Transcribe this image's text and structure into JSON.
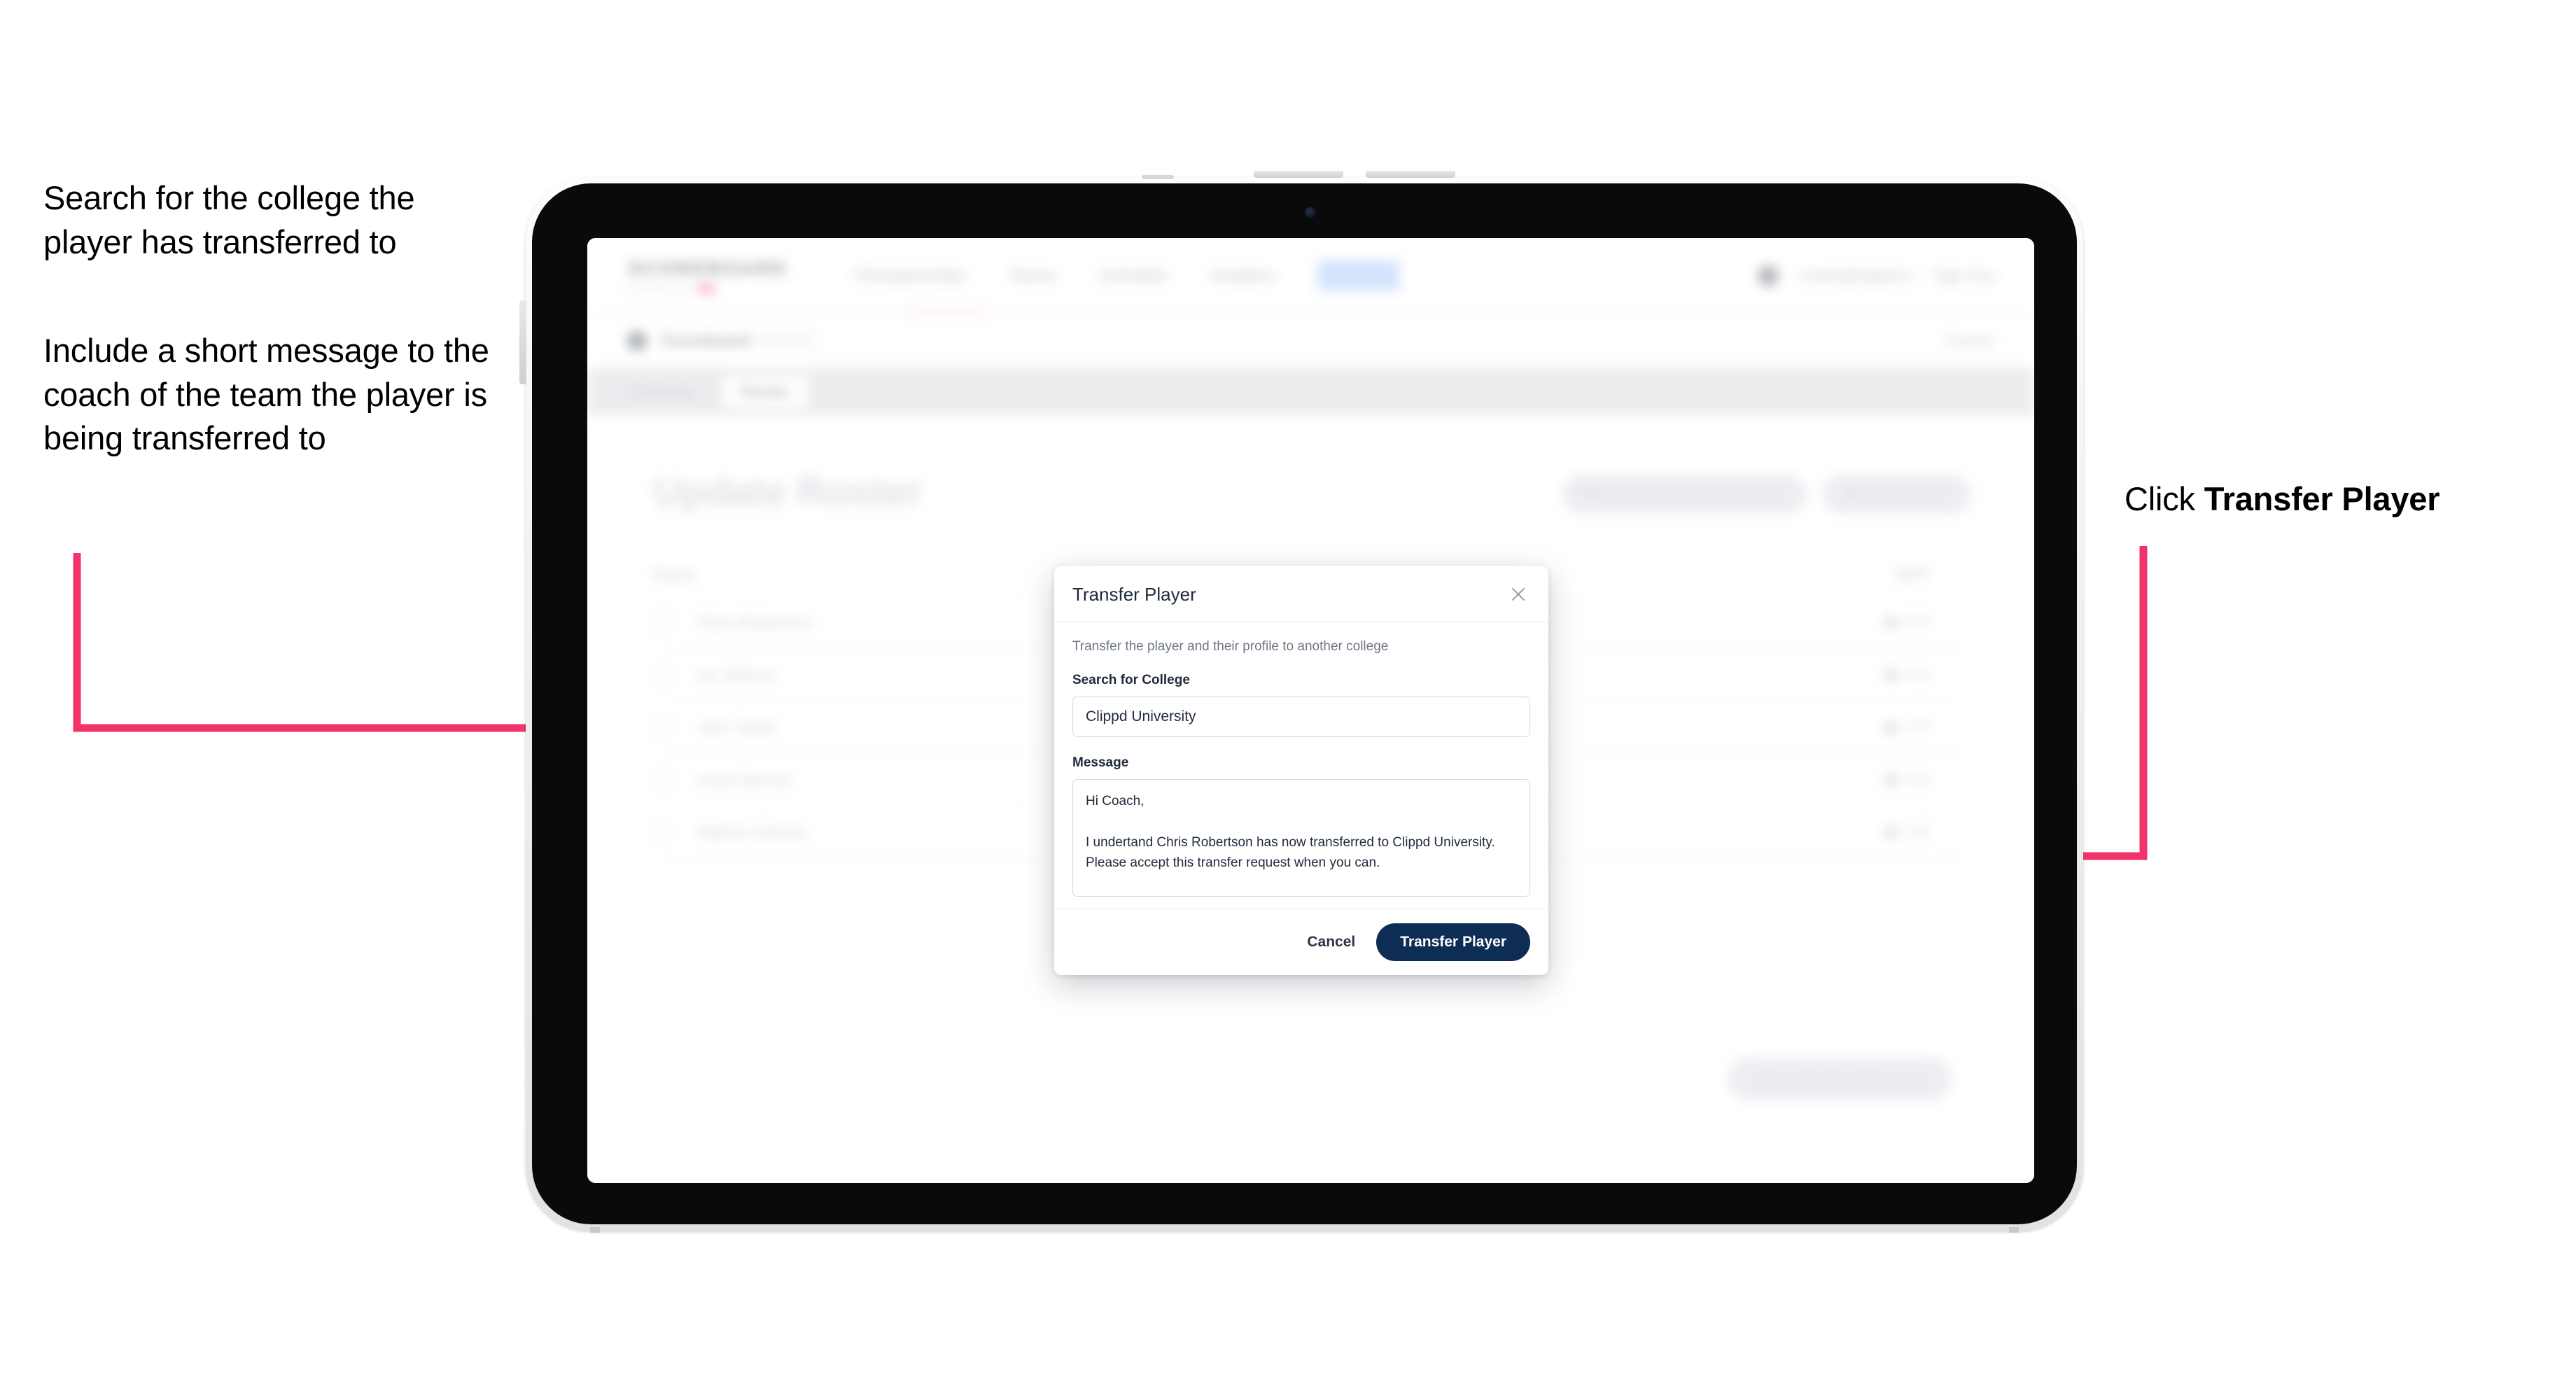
{
  "annotations": {
    "left_1": "Search for the college the player has transferred to",
    "left_2": "Include a short message to the coach of the team the player is being transferred to",
    "right_prefix": "Click ",
    "right_strong": "Transfer Player"
  },
  "colors": {
    "accent_pink": "#f2336b",
    "brand_navy": "#0e2d54",
    "brand_pink": "#f43f69"
  },
  "app": {
    "brand": {
      "word": "SCOREBOARD",
      "sub": "POWERED BY",
      "dot_icon": "brand-dot-icon"
    },
    "nav": [
      {
        "label": "Championships"
      },
      {
        "label": "Teams"
      },
      {
        "label": "Schedule"
      },
      {
        "label": "Analytics"
      },
      {
        "label": "Roster"
      }
    ],
    "top_right": {
      "avatar": "avatar-icon",
      "account": "coach@clippd.io",
      "signout": "Sign Out"
    },
    "subbar": {
      "icon": "scoreboard-icon",
      "title": "Scoreboard",
      "title_dim": "2024/25",
      "right": "Cancel"
    },
    "tabs": [
      {
        "label": "Overview",
        "active": false
      },
      {
        "label": "Roster",
        "active": true
      }
    ],
    "page_title": "Update Roster",
    "head_actions": [
      {
        "label": "Request Player Transfer",
        "icon": "transfer-icon"
      },
      {
        "label": "Add Player",
        "icon": "plus-icon"
      }
    ],
    "roster": {
      "columns": {
        "name": "Name",
        "edit": "EDIT"
      },
      "rows": [
        {
          "name": "Chris Robertson",
          "edit": "Edit"
        },
        {
          "name": "Ian Watson",
          "edit": "Edit"
        },
        {
          "name": "John Taylor",
          "edit": "Edit"
        },
        {
          "name": "Lewis Barnes",
          "edit": "Edit"
        },
        {
          "name": "Nathan Holmes",
          "edit": "Edit"
        }
      ]
    },
    "save_label": "Save Roster Changes"
  },
  "modal": {
    "title": "Transfer Player",
    "close_icon": "close-icon",
    "description": "Transfer the player and their profile to another college",
    "college": {
      "label": "Search for College",
      "value": "Clippd University",
      "placeholder": "Search for College"
    },
    "message": {
      "label": "Message",
      "value": "Hi Coach,\n\nI undertand Chris Robertson has now transferred to Clippd University. Please accept this transfer request when you can.",
      "placeholder": "Message"
    },
    "cancel_label": "Cancel",
    "submit_label": "Transfer Player"
  }
}
